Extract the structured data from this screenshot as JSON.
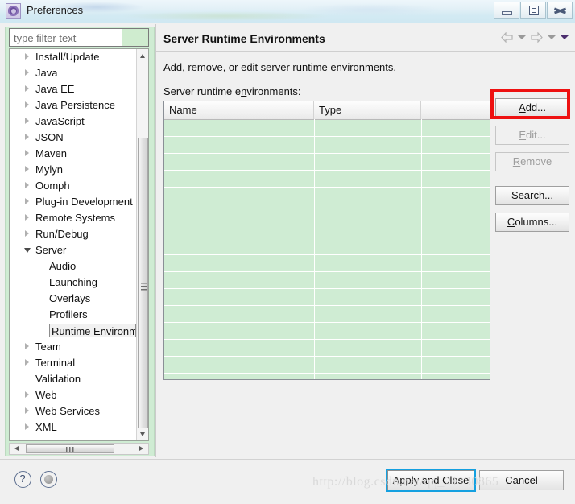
{
  "window": {
    "title": "Preferences",
    "icon": "preferences-gear-icon",
    "controls": {
      "minimize": "minimize-icon",
      "restore": "restore-icon",
      "close": "close-icon"
    }
  },
  "sidebar": {
    "filter": {
      "value": "",
      "placeholder": "type filter text"
    },
    "items": [
      {
        "label": "Install/Update",
        "level": 0,
        "expandable": true,
        "expanded": false,
        "selected": false
      },
      {
        "label": "Java",
        "level": 0,
        "expandable": true,
        "expanded": false,
        "selected": false
      },
      {
        "label": "Java EE",
        "level": 0,
        "expandable": true,
        "expanded": false,
        "selected": false
      },
      {
        "label": "Java Persistence",
        "level": 0,
        "expandable": true,
        "expanded": false,
        "selected": false
      },
      {
        "label": "JavaScript",
        "level": 0,
        "expandable": true,
        "expanded": false,
        "selected": false
      },
      {
        "label": "JSON",
        "level": 0,
        "expandable": true,
        "expanded": false,
        "selected": false
      },
      {
        "label": "Maven",
        "level": 0,
        "expandable": true,
        "expanded": false,
        "selected": false
      },
      {
        "label": "Mylyn",
        "level": 0,
        "expandable": true,
        "expanded": false,
        "selected": false
      },
      {
        "label": "Oomph",
        "level": 0,
        "expandable": true,
        "expanded": false,
        "selected": false
      },
      {
        "label": "Plug-in Development",
        "level": 0,
        "expandable": true,
        "expanded": false,
        "selected": false
      },
      {
        "label": "Remote Systems",
        "level": 0,
        "expandable": true,
        "expanded": false,
        "selected": false
      },
      {
        "label": "Run/Debug",
        "level": 0,
        "expandable": true,
        "expanded": false,
        "selected": false
      },
      {
        "label": "Server",
        "level": 0,
        "expandable": true,
        "expanded": true,
        "selected": false
      },
      {
        "label": "Audio",
        "level": 1,
        "expandable": false,
        "expanded": false,
        "selected": false
      },
      {
        "label": "Launching",
        "level": 1,
        "expandable": false,
        "expanded": false,
        "selected": false
      },
      {
        "label": "Overlays",
        "level": 1,
        "expandable": false,
        "expanded": false,
        "selected": false
      },
      {
        "label": "Profilers",
        "level": 1,
        "expandable": false,
        "expanded": false,
        "selected": false
      },
      {
        "label": "Runtime Environm",
        "level": 1,
        "expandable": false,
        "expanded": false,
        "selected": true
      },
      {
        "label": "Team",
        "level": 0,
        "expandable": true,
        "expanded": false,
        "selected": false
      },
      {
        "label": "Terminal",
        "level": 0,
        "expandable": true,
        "expanded": false,
        "selected": false
      },
      {
        "label": "Validation",
        "level": 0,
        "expandable": false,
        "expanded": false,
        "selected": false
      },
      {
        "label": "Web",
        "level": 0,
        "expandable": true,
        "expanded": false,
        "selected": false
      },
      {
        "label": "Web Services",
        "level": 0,
        "expandable": true,
        "expanded": false,
        "selected": false
      },
      {
        "label": "XML",
        "level": 0,
        "expandable": true,
        "expanded": false,
        "selected": false
      }
    ]
  },
  "page": {
    "title": "Server Runtime Environments",
    "description": "Add, remove, or edit server runtime environments.",
    "list_label_prefix": "Server runtime e",
    "list_label_mnemonic": "n",
    "list_label_suffix": "vironments:",
    "nav": {
      "back": "back-arrow-icon",
      "back_menu": "chevron-down-icon",
      "forward": "forward-arrow-icon",
      "forward_menu": "chevron-down-icon",
      "view_menu": "view-menu-chevron-icon"
    }
  },
  "table": {
    "columns": [
      "Name",
      "Type",
      ""
    ],
    "rows": [],
    "empty_row_count": 19
  },
  "buttons": {
    "add": {
      "prefix": "",
      "mnemonic": "A",
      "suffix": "dd...",
      "enabled": true,
      "highlighted": true
    },
    "edit": {
      "prefix": "",
      "mnemonic": "E",
      "suffix": "dit...",
      "enabled": false,
      "highlighted": false
    },
    "remove": {
      "prefix": "",
      "mnemonic": "R",
      "suffix": "emove",
      "enabled": false,
      "highlighted": false
    },
    "search": {
      "prefix": "",
      "mnemonic": "S",
      "suffix": "earch...",
      "enabled": true,
      "highlighted": false
    },
    "columns": {
      "prefix": "",
      "mnemonic": "C",
      "suffix": "olumns...",
      "enabled": true,
      "highlighted": false
    }
  },
  "footer": {
    "help_icon": "help-icon",
    "restore_defaults_icon": "restore-defaults-icon",
    "apply_and_close": "Apply and Close",
    "cancel": "Cancel"
  },
  "watermark": "http://blog.csdn.net/qq_21130865",
  "colors": {
    "highlight_red": "#ee1111",
    "table_green": "#cfecd3",
    "panel_green": "#cfecd3",
    "focus_blue": "#14a0e0",
    "title_gradient_start": "#eef6fb",
    "title_gradient_end": "#cfe8f2"
  }
}
